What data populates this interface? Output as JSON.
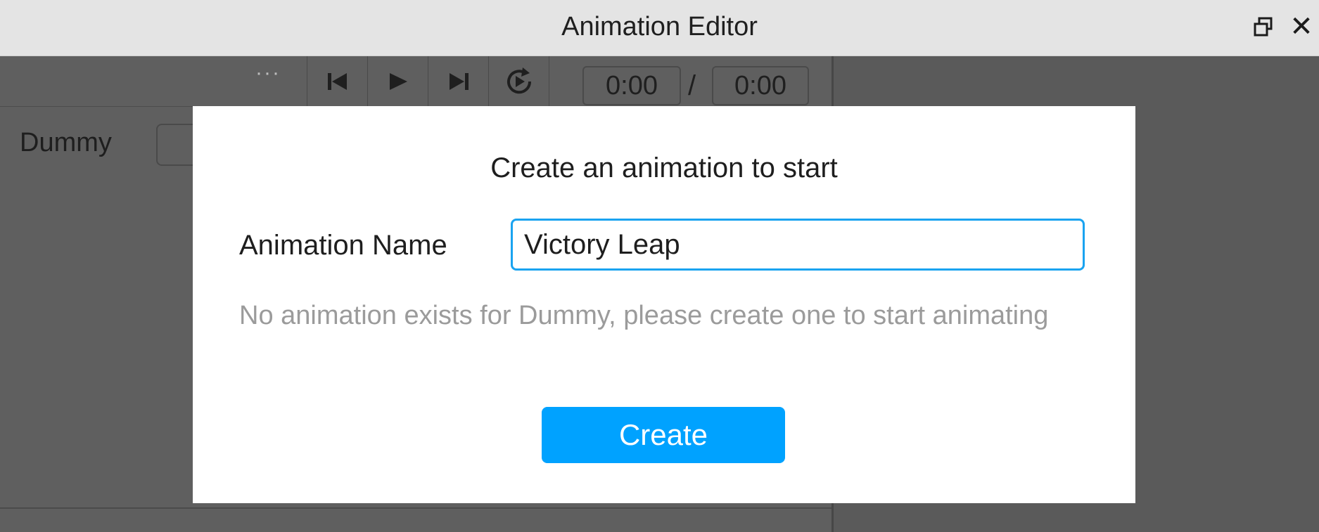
{
  "window": {
    "title": "Animation Editor",
    "restore_icon": "restore-window-icon",
    "close_glyph": "✕"
  },
  "toolbar": {
    "more_glyph": "···",
    "buttons": [
      {
        "name": "skip-to-start-icon"
      },
      {
        "name": "play-icon"
      },
      {
        "name": "skip-to-end-icon"
      },
      {
        "name": "loop-icon"
      }
    ],
    "current_time": "0:00",
    "time_separator": "/",
    "total_time": "0:00"
  },
  "rig": {
    "label": "Dummy"
  },
  "dialog": {
    "heading": "Create an animation to start",
    "name_label": "Animation Name",
    "name_value": "Victory Leap",
    "hint": "No animation exists for Dummy, please create one to start animating",
    "create_label": "Create"
  },
  "colors": {
    "accent": "#00a2ff",
    "focus_border": "#1aa3f0",
    "hint_text": "#9b9b9b",
    "workspace": "#5f5f5f"
  }
}
